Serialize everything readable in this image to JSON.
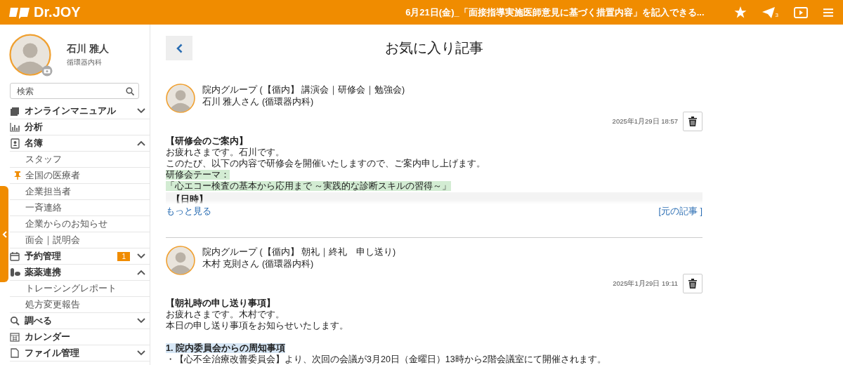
{
  "header": {
    "logo": "Dr.JOY",
    "ticker": "6月21日(金)_「面接指導実施医師意見に基づく措置内容」を記入できる...",
    "send_count": "3"
  },
  "profile": {
    "name": "石川 雅人",
    "department": "循環器内科"
  },
  "search": {
    "placeholder": "検索"
  },
  "menu": [
    {
      "kind": "section",
      "label": "オンラインマニュアル",
      "expanded": false
    },
    {
      "kind": "section",
      "label": "分析"
    },
    {
      "kind": "section",
      "label": "名簿",
      "expanded": true
    },
    {
      "kind": "sub",
      "label": "スタッフ",
      "pinned": false
    },
    {
      "kind": "sub",
      "label": "全国の医療者",
      "pinned": true
    },
    {
      "kind": "sub",
      "label": "企業担当者",
      "pinned": false
    },
    {
      "kind": "sub",
      "label": "一斉連絡",
      "pinned": false
    },
    {
      "kind": "sub",
      "label": "企業からのお知らせ",
      "pinned": false
    },
    {
      "kind": "sub",
      "label": "面会｜説明会",
      "pinned": false
    },
    {
      "kind": "section",
      "label": "予約管理",
      "expanded": false,
      "badge": "1"
    },
    {
      "kind": "section",
      "label": "薬薬連携",
      "expanded": true
    },
    {
      "kind": "sub",
      "label": "トレーシングレポート",
      "pinned": false
    },
    {
      "kind": "sub",
      "label": "処方変更報告",
      "pinned": false
    },
    {
      "kind": "section",
      "label": "調べる",
      "expanded": false
    },
    {
      "kind": "section",
      "label": "カレンダー"
    },
    {
      "kind": "section",
      "label": "ファイル管理",
      "expanded": false
    }
  ],
  "page": {
    "title": "お気に入り記事"
  },
  "articles": [
    {
      "group": "院内グループ (【循内】 講演会｜研修会｜勉強会)",
      "author": "石川 雅人さん (循環器内科)",
      "date": "2025年1月29日 18:57",
      "collapsed": true,
      "more": "もっと見る",
      "original": "[元の記事 ]",
      "lines": [
        {
          "kind": "heading",
          "text": "【研修会のご案内】"
        },
        {
          "kind": "plain",
          "text": "お疲れさまです。石川です。"
        },
        {
          "kind": "plain",
          "text": "このたび、以下の内容で研修会を開催いたしますので、ご案内申し上げます。"
        },
        {
          "kind": "marked",
          "text": "研修会テーマ："
        },
        {
          "kind": "marked",
          "text": "「心エコー検査の基本から応用まで ～実践的な診断スキルの習得～」"
        },
        {
          "kind": "boxed",
          "text": "【日時】"
        }
      ]
    },
    {
      "group": "院内グループ (【循内】 朝礼｜終礼　申し送り)",
      "author": "木村 克則さん (循環器内科)",
      "date": "2025年1月29日 19:11",
      "collapsed": false,
      "lines": [
        {
          "kind": "heading",
          "text": "【朝礼時の申し送り事項】"
        },
        {
          "kind": "plain",
          "text": "お疲れさまです。木村です。"
        },
        {
          "kind": "plain",
          "text": "本日の申し送り事項をお知らせいたします。"
        },
        {
          "kind": "topic",
          "text": "1. 院内委員会からの周知事項"
        },
        {
          "kind": "plain",
          "text": "・【心不全治療改善委員会】より、次回の会議が3月20日（金曜日）13時から2階会議室にて開催されます。"
        }
      ]
    }
  ]
}
